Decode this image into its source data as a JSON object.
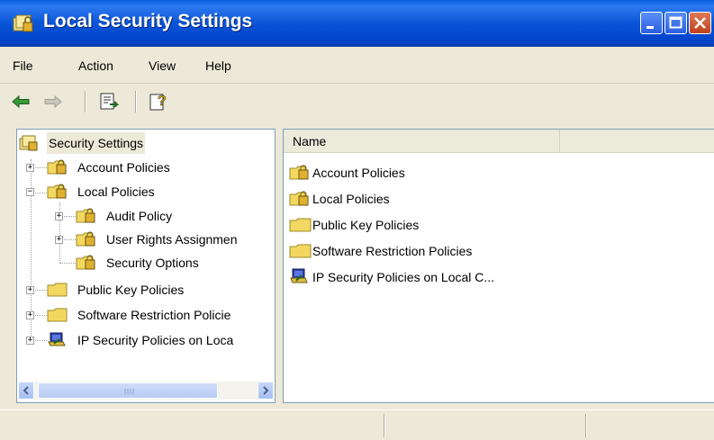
{
  "window": {
    "title": "Local Security Settings",
    "title_icon": "security-settings-icon"
  },
  "menu": [
    {
      "label": "File"
    },
    {
      "label": "Action"
    },
    {
      "label": "View"
    },
    {
      "label": "Help"
    }
  ],
  "toolbar": {
    "back_icon": "back-arrow-icon",
    "forward_icon": "forward-arrow-icon",
    "export_icon": "export-list-icon",
    "help_icon": "help-icon"
  },
  "tree": {
    "root": "Security Settings",
    "items": [
      {
        "label": "Account Policies"
      },
      {
        "label": "Local Policies"
      },
      {
        "label": "Audit Policy"
      },
      {
        "label": "User Rights Assignmen"
      },
      {
        "label": "Security Options"
      },
      {
        "label": "Public Key Policies"
      },
      {
        "label": "Software Restriction Policie"
      },
      {
        "label": "IP Security Policies on Loca"
      }
    ]
  },
  "list": {
    "column_name": "Name",
    "rows": [
      {
        "label": "Account Policies",
        "icon": "security-folder-icon"
      },
      {
        "label": "Local Policies",
        "icon": "security-folder-icon"
      },
      {
        "label": "Public Key Policies",
        "icon": "folder-icon"
      },
      {
        "label": "Software Restriction Policies",
        "icon": "folder-icon"
      },
      {
        "label": "IP Security Policies on Local C...",
        "icon": "ip-security-icon"
      }
    ]
  },
  "colors": {
    "titlebar_blue": "#0a54d6",
    "chrome": "#ece9d8",
    "folder_yellow": "#f2d860"
  }
}
